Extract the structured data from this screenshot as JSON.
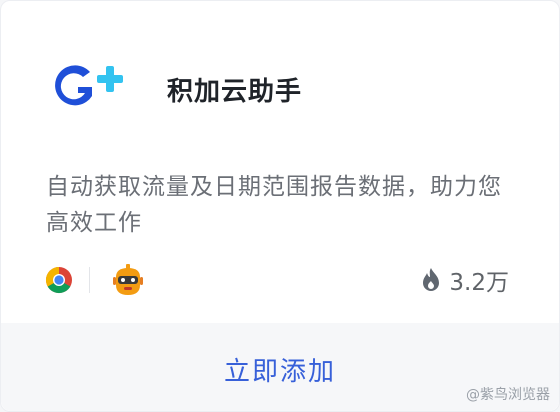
{
  "app": {
    "name": "积加云助手",
    "description": "自动获取流量及日期范围报告数据，助力您高效工作",
    "users": "3.2万",
    "add_label": "立即添加",
    "logo_icon": "g-plus-logo-icon",
    "brand_color": "#1f4fd8",
    "accent_color": "#3760d9"
  },
  "browsers": [
    {
      "icon": "chrome-icon"
    },
    {
      "icon": "robot-browser-icon"
    }
  ],
  "watermark": "@紫鸟浏览器"
}
